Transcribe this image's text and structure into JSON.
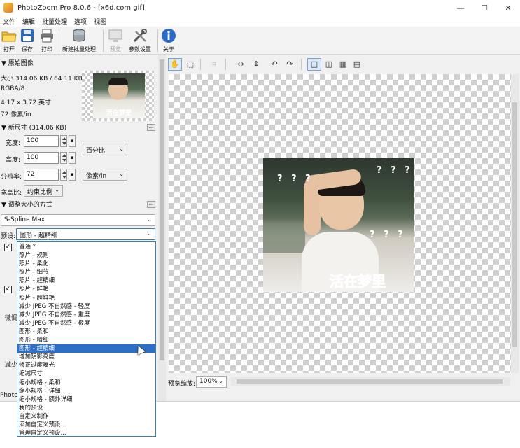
{
  "window": {
    "title": "PhotoZoom Pro 8.0.6 - [x6d.com.gif]",
    "minimize": "—",
    "maximize": "☐",
    "close": "✕"
  },
  "menu": [
    "文件",
    "编辑",
    "批量处理",
    "选项",
    "视图"
  ],
  "toolbar": {
    "open": "打开",
    "save": "保存",
    "print": "打印",
    "new_batch": "新建批量处理",
    "preview": "预览",
    "settings": "参数设置",
    "about": "关于"
  },
  "original_image": {
    "header": "▼ 原始图像",
    "size": "大小 314.06 KB / 64.11 KB",
    "mode": "RGBA/8",
    "dimensions": "4.17 x 3.72 英寸",
    "resolution": "72 像素/in",
    "thumb_caption": "活在梦里"
  },
  "new_size": {
    "header": "▼ 新尺寸 (314.06 KB)",
    "more_btn": "...",
    "width_label": "宽度:",
    "width_value": "100",
    "height_label": "高度:",
    "height_value": "100",
    "unit": "百分比",
    "resolution_label": "分辨率:",
    "resolution_value": "72",
    "resolution_unit": "像素/in",
    "aspect_label": "宽高比:",
    "aspect_value": "约束比例"
  },
  "resize_method": {
    "header": "▼ 调整大小的方式",
    "more_btn": "...",
    "method": "S-Spline Max",
    "preset_label": "预设:",
    "preset_value": "图形 - 超精细"
  },
  "partial_labels": {
    "check1": "",
    "check2": "",
    "fine": "微调",
    "reduce": "减少",
    "status": "Photo"
  },
  "preset_options": [
    "普通 *",
    "照片 - 规则",
    "照片 - 柔化",
    "照片 - 细节",
    "照片 - 超精细",
    "照片 - 鲜艳",
    "照片 - 超鲜艳",
    "减少 JPEG 不自然感 - 轻度",
    "减少 JPEG 不自然感 - 重度",
    "减少 JPEG 不自然感 - 极度",
    "图形 - 柔和",
    "图形 - 精细",
    "图形 - 超精细",
    "增加阴影亮度",
    "修正过度曝光",
    "缩减尺寸",
    "缩小规格 - 柔和",
    "缩小规格 - 详细",
    "缩小规格 - 额外详细",
    "我的预设",
    "自定义制作",
    "添加自定义预设...",
    "管理自定义预设..."
  ],
  "selected_preset_index": 12,
  "preview": {
    "caption": "活在梦里",
    "marks": "? ? ?",
    "zoom_label": "预览缩放:",
    "zoom_value": "100%"
  }
}
